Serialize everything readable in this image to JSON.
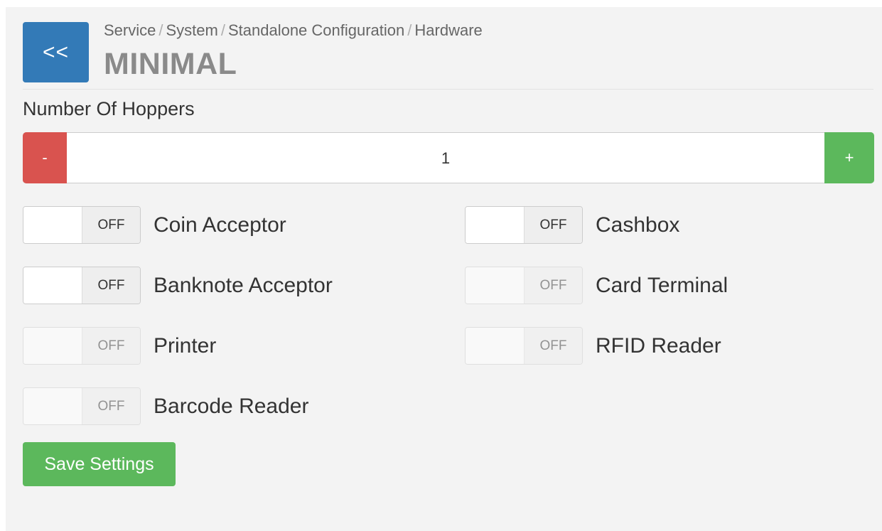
{
  "header": {
    "back_label": "<<",
    "breadcrumb": [
      "Service",
      "System",
      "Standalone Configuration",
      "Hardware"
    ],
    "title": "MINIMAL"
  },
  "hoppers": {
    "label": "Number Of Hoppers",
    "minus_label": "-",
    "plus_label": "+",
    "value": "1"
  },
  "toggles": [
    {
      "label": "Coin Acceptor",
      "state": "OFF",
      "enabled": true
    },
    {
      "label": "Cashbox",
      "state": "OFF",
      "enabled": true
    },
    {
      "label": "Banknote Acceptor",
      "state": "OFF",
      "enabled": true
    },
    {
      "label": "Card Terminal",
      "state": "OFF",
      "enabled": false
    },
    {
      "label": "Printer",
      "state": "OFF",
      "enabled": false
    },
    {
      "label": "RFID Reader",
      "state": "OFF",
      "enabled": false
    },
    {
      "label": "Barcode Reader",
      "state": "OFF",
      "enabled": false
    }
  ],
  "save_label": "Save Settings",
  "colors": {
    "primary": "#337ab7",
    "danger": "#d9534f",
    "success": "#5cb85c"
  }
}
